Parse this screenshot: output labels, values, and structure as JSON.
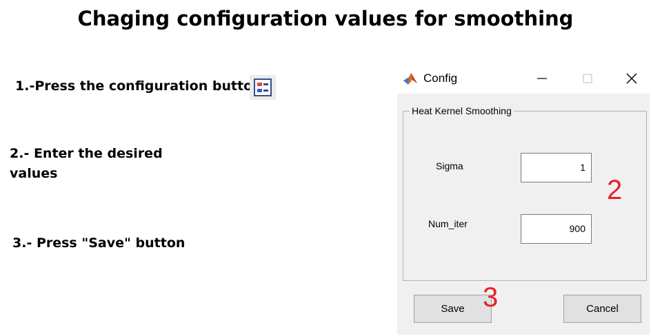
{
  "heading": "Chaging configuration values for smoothing",
  "steps": {
    "step1": "1.-Press the configuration button",
    "step2": "2.- Enter the desired values",
    "step3": "3.- Press \"Save\" button"
  },
  "config_button_icon": "configuration-icon",
  "dialog": {
    "title": "Config",
    "app_icon": "matlab-icon",
    "controls": [
      "minimize-icon",
      "maximize-icon",
      "close-icon"
    ],
    "group_label": "Heat Kernel Smoothing",
    "fields": {
      "sigma_label": "Sigma",
      "sigma_value": "1",
      "numiter_label": "Num_iter",
      "numiter_value": "900"
    },
    "buttons": {
      "save": "Save",
      "cancel": "Cancel"
    }
  },
  "annotations": {
    "n2": "2",
    "n3": "3",
    "color": "#e8202a"
  }
}
